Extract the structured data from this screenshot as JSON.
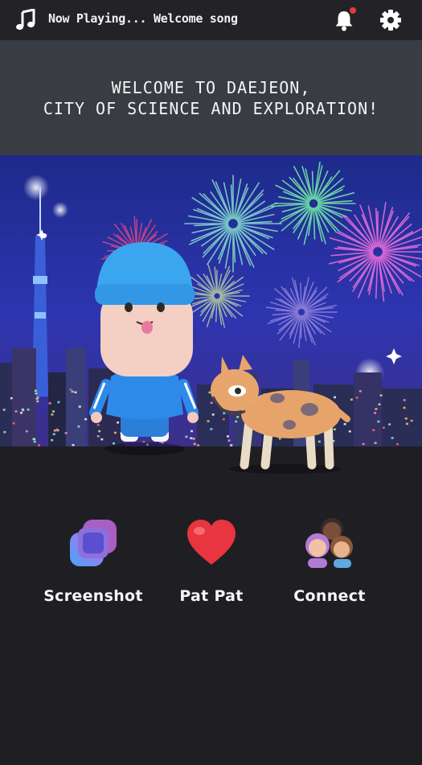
{
  "topbar": {
    "now_playing": "Now Playing... Welcome song",
    "icons": [
      "music-note-icon",
      "bell-icon",
      "gear-icon"
    ],
    "notification_dot_color": "#e53935"
  },
  "welcome": {
    "line1": "WELCOME TO DAEJEON,",
    "line2": "CITY OF SCIENCE AND EXPLORATION!"
  },
  "actions": [
    {
      "label": "Screenshot",
      "icon": "screenshot-frame-icon"
    },
    {
      "label": "Pat Pat",
      "icon": "heart-icon"
    },
    {
      "label": "Connect",
      "icon": "people-group-icon"
    }
  ],
  "colors": {
    "background": "#1f1f23",
    "banner": "#393c42",
    "heart": "#e8353f",
    "screenshot_gradient_start": "#4aa3ff",
    "screenshot_gradient_end": "#c06be0"
  }
}
